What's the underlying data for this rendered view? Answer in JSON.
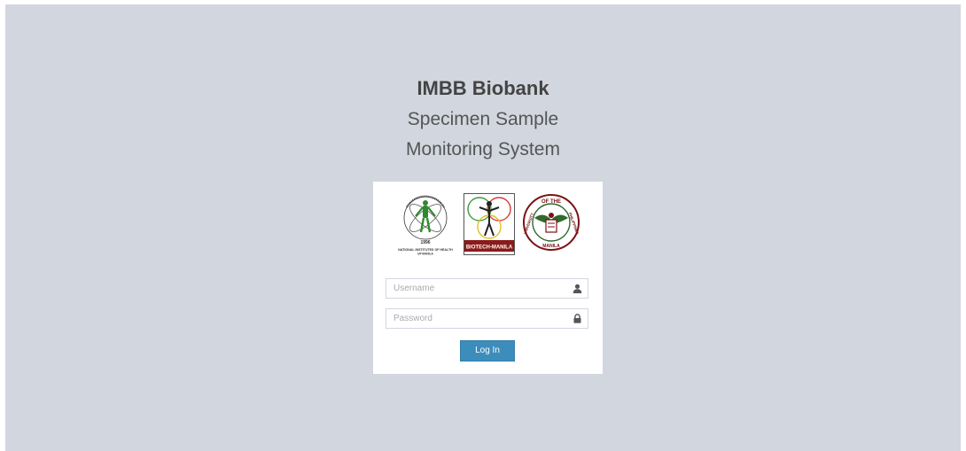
{
  "brand": {
    "title": "IMBB Biobank",
    "subtitle_line1": "Specimen Sample",
    "subtitle_line2": "Monitoring System"
  },
  "logos": {
    "nih": {
      "year": "1996",
      "name_line1": "NATIONAL INSTITUTES OF HEALTH",
      "name_line2": "UP MANILA"
    },
    "biotech": {
      "label": "BIOTECH-MANILA"
    },
    "up": {
      "text_top": "OF THE",
      "text_left": "UNIVERSITY",
      "text_right": "PHILIPPINES",
      "text_bottom": "MANILA"
    }
  },
  "login": {
    "username_placeholder": "Username",
    "password_placeholder": "Password",
    "submit_label": "Log In"
  },
  "colors": {
    "background": "#d2d6de",
    "button": "#3c8dbc",
    "biotech_red": "#8b1a1a",
    "up_green": "#2e6b2e",
    "up_maroon": "#7b1113"
  },
  "icons": {
    "username": "user-icon",
    "password": "lock-icon"
  }
}
